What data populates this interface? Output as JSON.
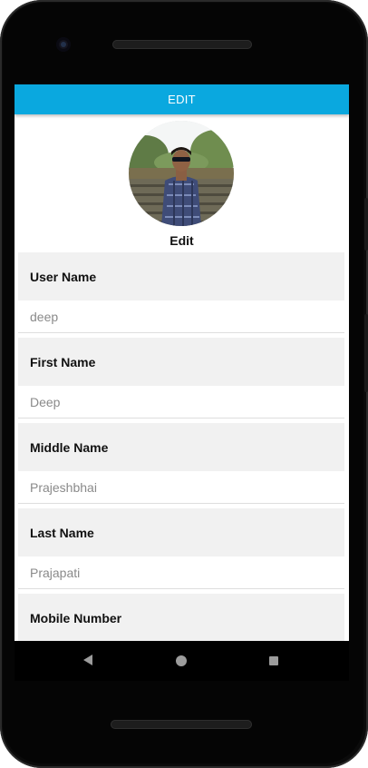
{
  "app_bar": {
    "title": "EDIT"
  },
  "profile": {
    "edit_label": "Edit"
  },
  "fields": [
    {
      "label": "User Name",
      "value": "deep"
    },
    {
      "label": "First Name",
      "value": "Deep"
    },
    {
      "label": "Middle Name",
      "value": "Prajeshbhai"
    },
    {
      "label": "Last Name",
      "value": "Prajapati"
    },
    {
      "label": "Mobile Number",
      "value": ""
    }
  ],
  "nav": {
    "back_icon": "back-triangle-icon",
    "home_icon": "home-circle-icon",
    "recents_icon": "recents-square-icon"
  },
  "colors": {
    "app_bar": "#0aa8df",
    "label_bg": "#f1f1f1",
    "value_text": "#8a8a8a"
  }
}
